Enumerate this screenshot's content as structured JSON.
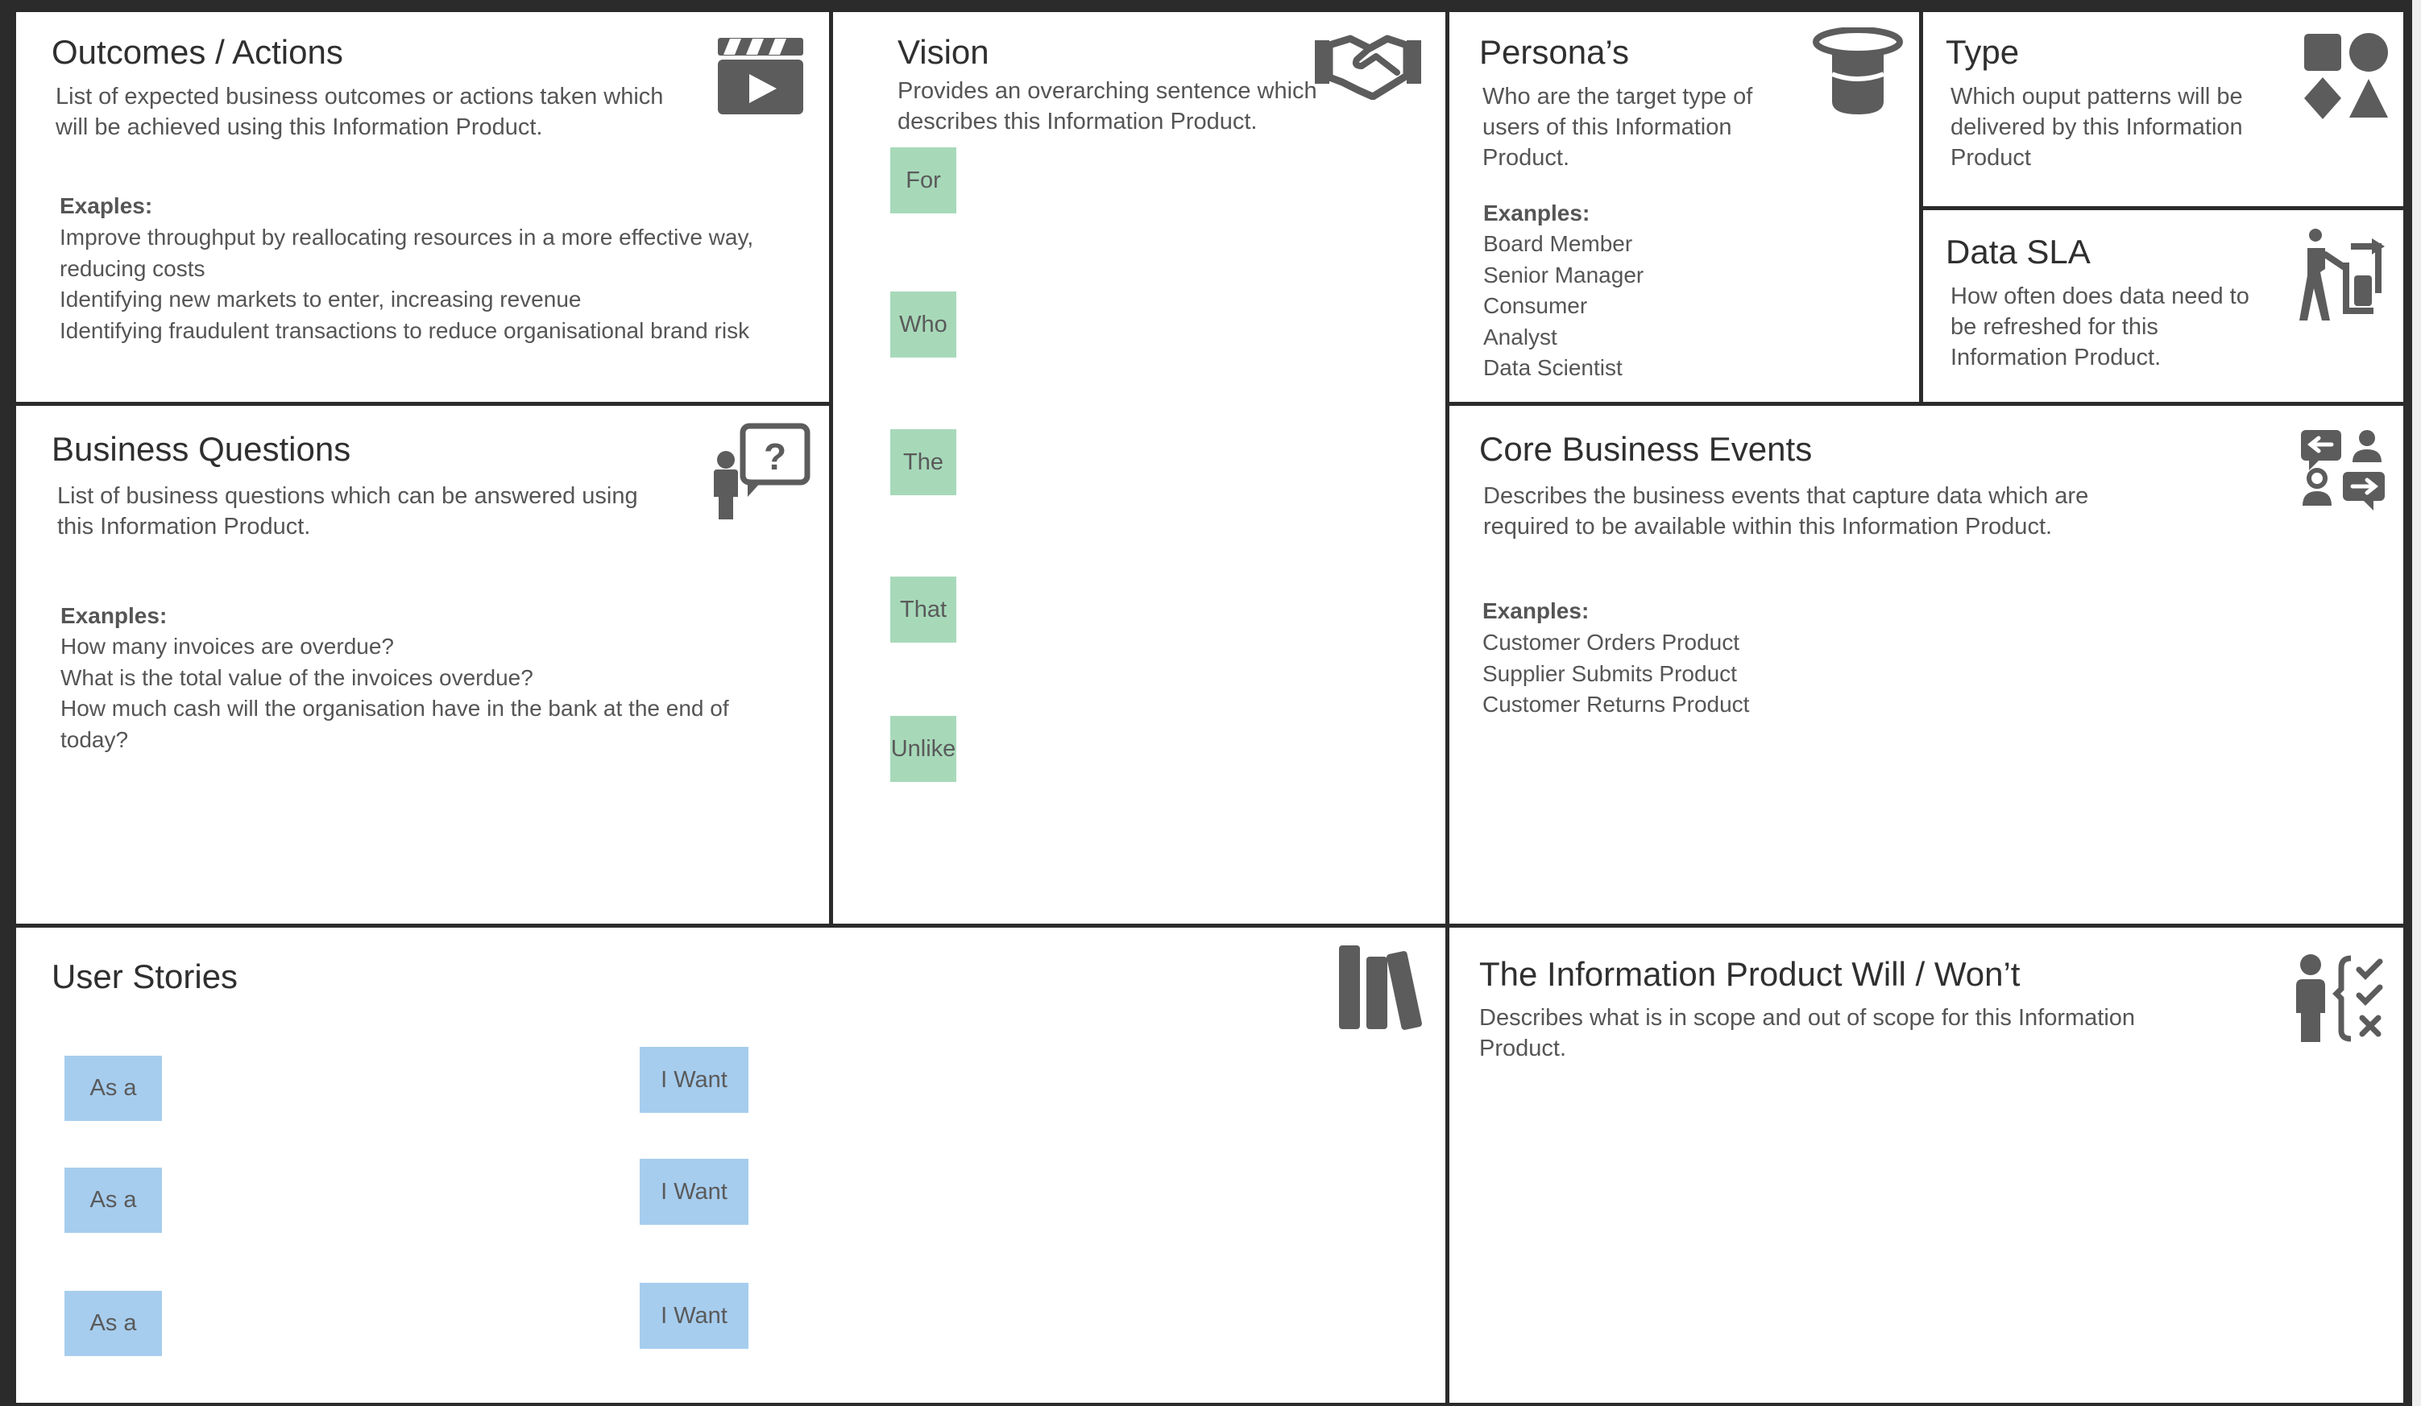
{
  "colors": {
    "border": "#2b2b2b",
    "title_text": "#2f2f2f",
    "body_text": "#555555",
    "icon_fill": "#5c5c5c",
    "sticky_green": "#a7d9b9",
    "sticky_blue": "#a6cdee"
  },
  "outcomes": {
    "title": "Outcomes / Actions",
    "description": "List of expected business outcomes or actions taken which will be achieved using this Information Product.",
    "examples_label": "Exaples:",
    "examples": [
      "Improve throughput by reallocating resources in a more effective way, reducing costs",
      "Identifying new markets to enter, increasing revenue",
      "Identifying fraudulent transactions to reduce organisational brand risk"
    ],
    "icon": "clapperboard-icon"
  },
  "business_questions": {
    "title": "Business Questions",
    "description": "List of business questions which can be answered using this Information Product.",
    "examples_label": "Exanples:",
    "examples": [
      "How many invoices are overdue?",
      "What is the total value of the invoices overdue?",
      "How much cash will the organisation have in the bank at the end of today?"
    ],
    "icon": "person-question-icon"
  },
  "vision": {
    "title": "Vision",
    "description": "Provides an overarching sentence which describes this Information Product.",
    "stickies": [
      "For",
      "Who",
      "The",
      "That",
      "Unlike"
    ],
    "icon": "handshake-icon"
  },
  "personas": {
    "title": "Persona’s",
    "description": "Who are the target type of users of this Information Product.",
    "examples_label": "Exanples:",
    "examples": [
      "Board Member",
      "Senior Manager",
      "Consumer",
      "Analyst",
      "Data Scientist"
    ],
    "icon": "top-hat-icon"
  },
  "type": {
    "title": "Type",
    "description": "Which ouput patterns will be delivered by this Information Product",
    "icon": "shapes-icon"
  },
  "data_sla": {
    "title": "Data SLA",
    "description": "How often does data need to be refreshed for this Information Product.",
    "icon": "person-refresh-icon"
  },
  "core_events": {
    "title": "Core Business Events",
    "description": "Describes the business events that capture data which are required to be available within this Information Product.",
    "examples_label": "Exanples:",
    "examples": [
      "Customer Orders Product",
      "Supplier Submits Product",
      "Customer Returns Product"
    ],
    "icon": "conversation-exchange-icon"
  },
  "user_stories": {
    "title": "User Stories",
    "as_a": [
      "As a",
      "As a",
      "As a"
    ],
    "i_want": [
      "I Want",
      "I Want",
      "I Want"
    ],
    "icon": "books-icon"
  },
  "will_wont": {
    "title": "The Information Product Will / Won’t",
    "description": "Describes what is in scope and out of scope for this Information Product.",
    "icon": "person-checklist-icon"
  }
}
